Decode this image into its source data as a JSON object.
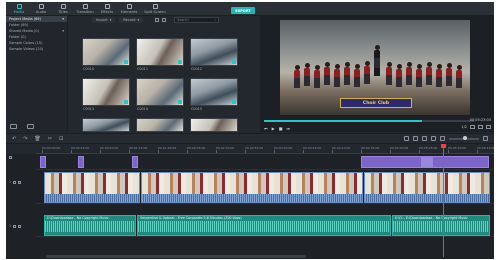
{
  "toolbar": {
    "tabs": [
      {
        "label": "Media",
        "icon": "folder-icon"
      },
      {
        "label": "Audio",
        "icon": "music-icon"
      },
      {
        "label": "Titles",
        "icon": "text-icon"
      },
      {
        "label": "Transition",
        "icon": "transition-icon"
      },
      {
        "label": "Effects",
        "icon": "effects-icon"
      },
      {
        "label": "Elements",
        "icon": "elements-icon"
      },
      {
        "label": "Split Screen",
        "icon": "split-screen-icon"
      }
    ],
    "export_label": "EXPORT"
  },
  "sidebar": {
    "items": [
      {
        "label": "Project Media (69)",
        "count": ""
      },
      {
        "label": "Folder (69)",
        "count": ""
      },
      {
        "label": "Shared Media (0)",
        "count": ""
      },
      {
        "label": "Folder (0)",
        "count": ""
      },
      {
        "label": "Sample Colors (15)",
        "count": ""
      },
      {
        "label": "Sample Videos (20)",
        "count": ""
      }
    ]
  },
  "media": {
    "import_label": "Import",
    "record_label": "Record",
    "search_placeholder": "Search",
    "thumbnails": [
      {
        "label": "C0010"
      },
      {
        "label": "C0011"
      },
      {
        "label": "C0012"
      },
      {
        "label": "C0013"
      },
      {
        "label": "C0014"
      },
      {
        "label": "C0015"
      },
      {
        "label": "",
        "partial": true
      },
      {
        "label": "",
        "partial": true
      },
      {
        "label": "",
        "partial": true
      }
    ]
  },
  "preview": {
    "banner_text": "Choir Club",
    "timecode": "00:05:23:03",
    "progress": 0.75,
    "quality_label": "1/2"
  },
  "ruler": {
    "ticks": [
      "00:00:00:00",
      "00:00:25:00",
      "00:00:50:00",
      "00:01:15:00",
      "00:01:40:00",
      "00:02:05:00",
      "00:02:30:00",
      "00:02:55:00",
      "00:03:20:00",
      "00:03:45:00",
      "00:04:10:00",
      "00:04:35:00",
      "00:05:00:00",
      "00:05:25:00",
      "00:05:50:00",
      "00:06:15:00"
    ]
  },
  "tracks": {
    "video_label": "1",
    "audio_label": "1",
    "audio_clips": [
      {
        "label": "E:\\Downloadsaa - No Copyright Music"
      },
      {
        "label": "Serpentine & Upbeat - Free Corporate 5-6 Minutes (320 kbps)"
      },
      {
        "label": "E:\\O... E:\\Downloadsaa - No Copyright Music"
      }
    ]
  },
  "colors": {
    "accent": "#29c6c4",
    "playhead": "#ff3b3b",
    "effects": "#7d64c8",
    "video_clip": "#4b6fa3",
    "audio_clip": "#1f8a7e"
  }
}
